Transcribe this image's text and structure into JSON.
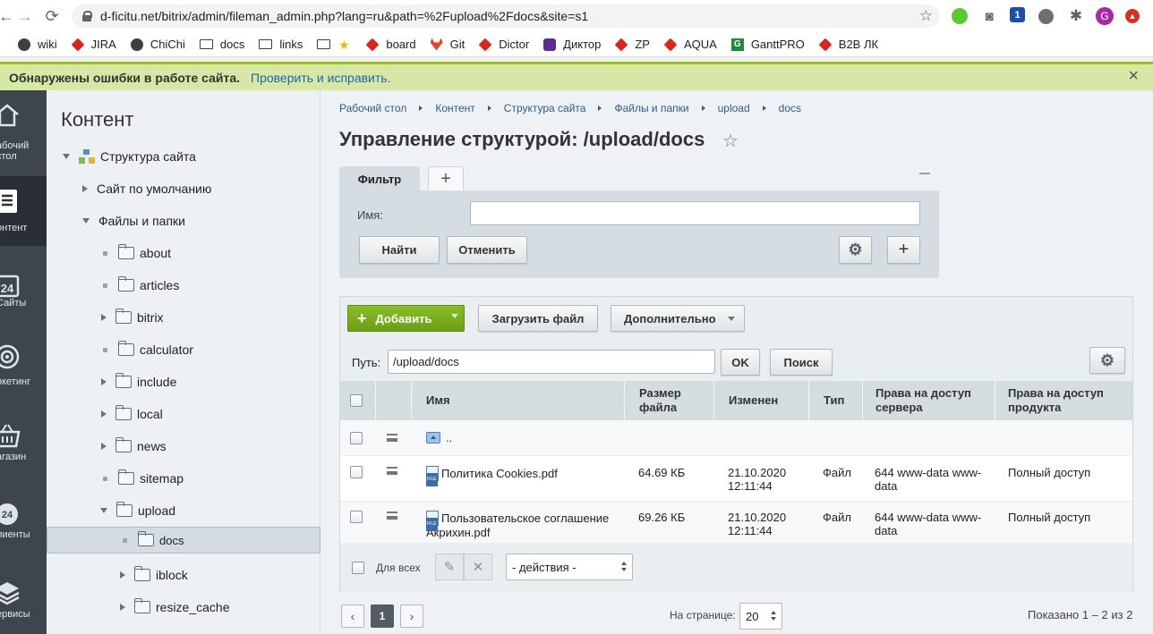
{
  "browser": {
    "url": "d-ficitu.net/bitrix/admin/fileman_admin.php?lang=ru&path=%2Fupload%2Fdocs&site=s1",
    "profile_initial": "G",
    "ext_badge": "1",
    "bookmarks": [
      "wiki",
      "JIRA",
      "ChiChi",
      "docs",
      "links",
      "",
      "board",
      "Git",
      "Dictor",
      "Диктор",
      "ZP",
      "AQUA",
      "GanttPRO",
      "B2B ЛК"
    ]
  },
  "notification": {
    "warning": "Обнаружены ошибки в работе сайта.",
    "link": "Проверить и исправить."
  },
  "rail": [
    {
      "label_1": "абочий",
      "label_2": "стол"
    },
    {
      "label_1": "онтент"
    },
    {
      "label_1": "Сайты",
      "badge": "24"
    },
    {
      "label_1": "ркетинг"
    },
    {
      "label_1": "агазин"
    },
    {
      "label_1": "лиенты",
      "badge": "24"
    },
    {
      "label_1": "ервисы"
    }
  ],
  "sidebar": {
    "title": "Контент",
    "tree": [
      {
        "label": "Структура сайта"
      },
      {
        "label": "Сайт по умолчанию"
      },
      {
        "label": "Файлы и папки"
      },
      {
        "label": "about"
      },
      {
        "label": "articles"
      },
      {
        "label": "bitrix"
      },
      {
        "label": "calculator"
      },
      {
        "label": "include"
      },
      {
        "label": "local"
      },
      {
        "label": "news"
      },
      {
        "label": "sitemap"
      },
      {
        "label": "upload"
      },
      {
        "label": "docs"
      },
      {
        "label": "iblock"
      },
      {
        "label": "resize_cache"
      }
    ]
  },
  "breadcrumbs": [
    "Рабочий стол",
    "Контент",
    "Структура сайта",
    "Файлы и папки",
    "upload",
    "docs"
  ],
  "page_title": "Управление структурой: /upload/docs",
  "filter": {
    "tab_label": "Фильтр",
    "name_label": "Имя:",
    "name_value": "",
    "find_label": "Найти",
    "cancel_label": "Отменить"
  },
  "list": {
    "add_label": "Добавить",
    "upload_label": "Загрузить файл",
    "more_label": "Дополнительно",
    "path_label": "Путь:",
    "path_value": "/upload/docs",
    "ok_label": "OK",
    "search_label": "Поиск",
    "columns": {
      "name": "Имя",
      "size": "Размер файла",
      "modified": "Изменен",
      "type": "Тип",
      "server_rights": "Права на доступ сервера",
      "product_rights": "Права на доступ продукта"
    },
    "parent_dir": "..",
    "rows": [
      {
        "name": "Политика Cookies.pdf",
        "size": "64.69 КБ",
        "modified": "21.10.2020 12:11:44",
        "type": "Файл",
        "server_rights": "644 www-data www-data",
        "product_rights": "Полный доступ"
      },
      {
        "name": "Пользовательское соглашение Акрихин.pdf",
        "size": "69.26 КБ",
        "modified": "21.10.2020 12:11:44",
        "type": "Файл",
        "server_rights": "644 www-data www-data",
        "product_rights": "Полный доступ"
      }
    ],
    "for_all_label": "Для всех",
    "actions_value": "- действия -"
  },
  "pager": {
    "current_page": "1",
    "per_page_label": "На странице:",
    "per_page_value": "20",
    "shown_text": "Показано 1 – 2 из 2"
  }
}
